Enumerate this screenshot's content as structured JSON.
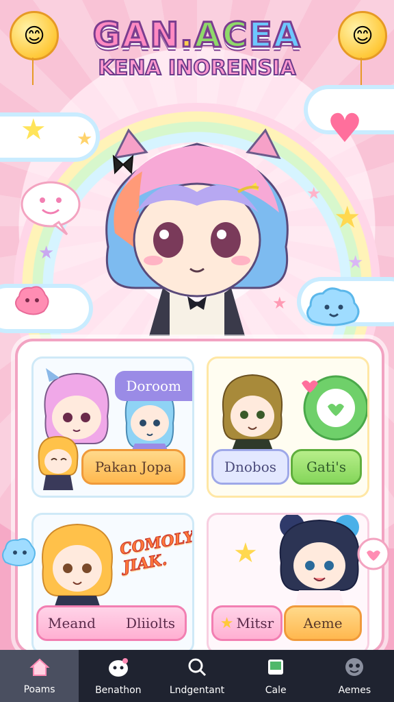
{
  "app": {
    "title_parts": [
      "GAN",
      ".",
      "AC",
      "EA"
    ],
    "title": "GAN.ACEA",
    "subtitle": "KENA INORENSIA"
  },
  "cards": [
    {
      "tag": "Doroom",
      "button": "Pakan Jopa"
    },
    {
      "button_left": "Dnobos",
      "button_right": "Gati's"
    },
    {
      "banner": "COMOLY JIAK.",
      "button_left": "Meand",
      "button_right": "Dliiolts"
    },
    {
      "button_left": "Mitsr",
      "button_right": "Aeme"
    }
  ],
  "nav": [
    {
      "label": "Poams",
      "icon": "home-icon",
      "active": true
    },
    {
      "label": "Benathon",
      "icon": "mascot-icon",
      "active": false
    },
    {
      "label": "Lndgentant",
      "icon": "search-icon",
      "active": false
    },
    {
      "label": "Cale",
      "icon": "card-icon",
      "active": false
    },
    {
      "label": "Aemes",
      "icon": "profile-icon",
      "active": false
    }
  ],
  "colors": {
    "accent_pink": "#ff7fb0",
    "accent_orange": "#ffb84f",
    "accent_green": "#85d65a",
    "accent_purple": "#9a8be6",
    "nav_bg": "#1f2330"
  }
}
